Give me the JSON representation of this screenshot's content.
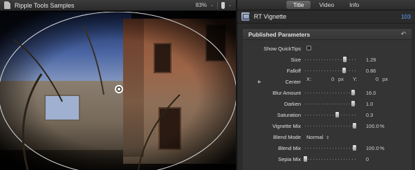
{
  "viewer": {
    "title": "Ripple Tools Samples",
    "zoom": "83%",
    "zoom_chevron": "⌄"
  },
  "inspector": {
    "tabs": [
      "Title",
      "Video",
      "Info"
    ],
    "active_tab": "Title",
    "effect_name": "RT Vignette",
    "effect_count": "103",
    "section_title": "Published Parameters",
    "reset_glyph": "↶",
    "rows": {
      "show_quicktips": {
        "label": "Show QuickTips",
        "checked": false
      },
      "size": {
        "label": "Size",
        "value": "1.29",
        "slider_fraction": 0.77
      },
      "falloff": {
        "label": "Falloff",
        "value": "0.86",
        "slider_fraction": 0.76
      },
      "center": {
        "label": "Center",
        "x_label": "X:",
        "x_value": "0",
        "x_unit": "px",
        "y_label": "Y:",
        "y_value": "0",
        "y_unit": "px",
        "disclosure": "▶"
      },
      "blur_amount": {
        "label": "Blur Amount",
        "value": "16.0",
        "slider_fraction": 0.93
      },
      "darken": {
        "label": "Darken",
        "value": "1.0",
        "slider_fraction": 0.93
      },
      "saturation": {
        "label": "Saturation",
        "value": "0.3",
        "slider_fraction": 0.62
      },
      "vignette_mix": {
        "label": "Vignette Mix",
        "value": "100.0",
        "unit": "%",
        "slider_fraction": 0.96
      },
      "blend_mode": {
        "label": "Blend Mode",
        "value": "Normal",
        "arrows": "⇕"
      },
      "blend_mix": {
        "label": "Blend Mix",
        "value": "100.0",
        "unit": "%",
        "slider_fraction": 0.96
      },
      "sepia_mix": {
        "label": "Sepia Mix",
        "value": "0",
        "slider_fraction": 0.0
      }
    }
  },
  "colors": {
    "accent": "#5aa3ff",
    "panel_bg": "#2b2b2b",
    "params_bg": "#343434"
  },
  "icons": {
    "document": "document-icon",
    "thermometer": "thermometer-icon",
    "effect": "effect-icon",
    "reset": "reset-icon"
  }
}
